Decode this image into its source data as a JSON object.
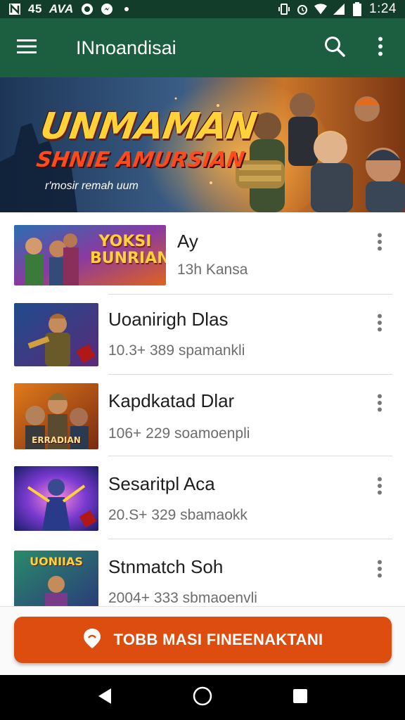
{
  "status_bar": {
    "left_text": "45",
    "left_extra": "AVA",
    "time": "1:24",
    "icons": [
      "notification-n-icon",
      "whatsapp-icon",
      "messenger-icon",
      "dot-icon",
      "vibrate-icon",
      "alarm-icon",
      "wifi-icon",
      "signal-icon",
      "battery-icon"
    ]
  },
  "app_bar": {
    "title": "INnoandisai",
    "icons": [
      "menu-icon",
      "search-icon",
      "more-vert-icon"
    ]
  },
  "banner": {
    "title_line1": "UNMAMAN",
    "title_line2": "SHNIE AMURSIAN",
    "tagline": "r'mosir remah uum"
  },
  "items": [
    {
      "title": "Ay",
      "subtitle": "13h Kansa",
      "thumb_text": "YOKSI BUNRIAN"
    },
    {
      "title": "Uoanirigh Dlas",
      "subtitle": "10.3+ 389 spamankli",
      "thumb_text": ""
    },
    {
      "title": "Kapdkatad Dlar",
      "subtitle": "106+ 229 soamoenpli",
      "thumb_text": "ERRADIAN"
    },
    {
      "title": "Sesaritpl Aca",
      "subtitle": "20.S+ 329 sbamaokk",
      "thumb_text": ""
    },
    {
      "title": "Stnmatch Soh",
      "subtitle": "2004+ 333 sbmaoenvli",
      "thumb_text": "UONIIAS"
    }
  ],
  "cta": {
    "label": "TOBB MASI FINEENAKTANI"
  },
  "nav": {
    "icons": [
      "back-icon",
      "home-icon",
      "recents-icon"
    ]
  },
  "colors": {
    "app_bar": "#1b5e40",
    "status_bar": "#123d2a",
    "cta": "#dd4d10"
  }
}
